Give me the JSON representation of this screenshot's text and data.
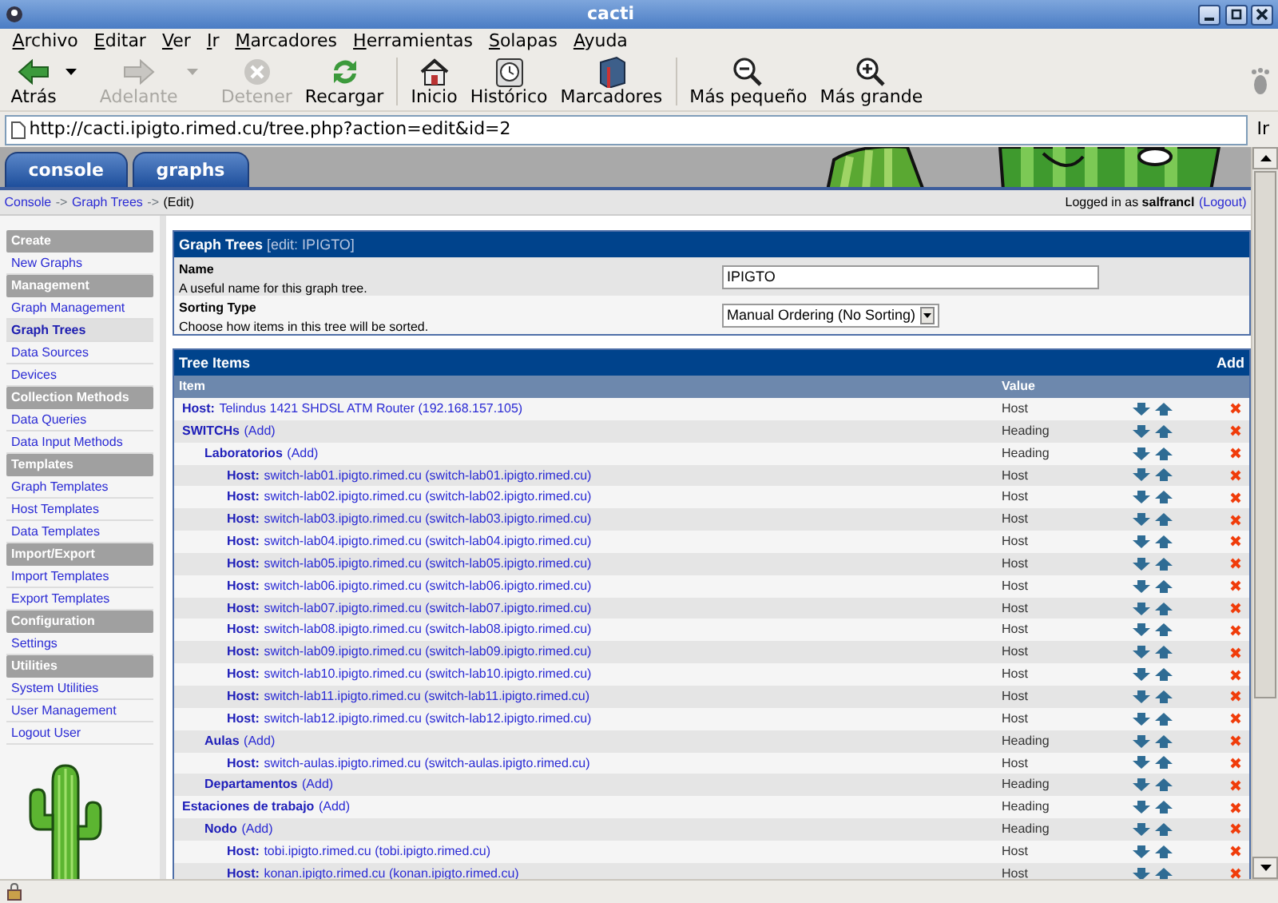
{
  "window": {
    "title": "cacti"
  },
  "menu": [
    "Archivo",
    "Editar",
    "Ver",
    "Ir",
    "Marcadores",
    "Herramientas",
    "Solapas",
    "Ayuda"
  ],
  "toolbar": [
    {
      "kind": "back",
      "label": "Atrás",
      "disabled": false,
      "dropdown": true
    },
    {
      "kind": "forward",
      "label": "Adelante",
      "disabled": true,
      "dropdown": true
    },
    {
      "kind": "stop",
      "label": "Detener",
      "disabled": true,
      "dropdown": false
    },
    {
      "kind": "reload",
      "label": "Recargar",
      "disabled": false,
      "dropdown": false
    },
    {
      "kind": "sep"
    },
    {
      "kind": "home",
      "label": "Inicio",
      "disabled": false,
      "dropdown": false
    },
    {
      "kind": "history",
      "label": "Histórico",
      "disabled": false,
      "dropdown": false
    },
    {
      "kind": "bookmarks",
      "label": "Marcadores",
      "disabled": false,
      "dropdown": false
    },
    {
      "kind": "sep"
    },
    {
      "kind": "zoomout",
      "label": "Más pequeño",
      "disabled": false,
      "dropdown": false
    },
    {
      "kind": "zoomin",
      "label": "Más grande",
      "disabled": false,
      "dropdown": false
    }
  ],
  "address": {
    "url": "http://cacti.ipigto.rimed.cu/tree.php?action=edit&id=2",
    "go": "Ir"
  },
  "tabs": [
    "console",
    "graphs"
  ],
  "breadcrumb": [
    {
      "kind": "link",
      "text": "Console"
    },
    {
      "kind": "sep",
      "text": "->"
    },
    {
      "kind": "link",
      "text": "Graph Trees"
    },
    {
      "kind": "sep",
      "text": "->"
    },
    {
      "kind": "text",
      "text": "(Edit)"
    }
  ],
  "login": {
    "text": "Logged in as **salfrancl**",
    "link": "(Logout)"
  },
  "sidebar": [
    {
      "title": "Create",
      "items": [
        {
          "label": "New Graphs",
          "selected": false
        }
      ]
    },
    {
      "title": "Management",
      "items": [
        {
          "label": "Graph Management",
          "selected": false
        },
        {
          "label": "Graph Trees",
          "selected": true
        },
        {
          "label": "Data Sources",
          "selected": false
        },
        {
          "label": "Devices",
          "selected": false
        }
      ]
    },
    {
      "title": "Collection Methods",
      "items": [
        {
          "label": "Data Queries",
          "selected": false
        },
        {
          "label": "Data Input Methods",
          "selected": false
        }
      ]
    },
    {
      "title": "Templates",
      "items": [
        {
          "label": "Graph Templates",
          "selected": false
        },
        {
          "label": "Host Templates",
          "selected": false
        },
        {
          "label": "Data Templates",
          "selected": false
        }
      ]
    },
    {
      "title": "Import/Export",
      "items": [
        {
          "label": "Import Templates",
          "selected": false
        },
        {
          "label": "Export Templates",
          "selected": false
        }
      ]
    },
    {
      "title": "Configuration",
      "items": [
        {
          "label": "Settings",
          "selected": false
        }
      ]
    },
    {
      "title": "Utilities",
      "items": [
        {
          "label": "System Utilities",
          "selected": false
        },
        {
          "label": "User Management",
          "selected": false
        },
        {
          "label": "Logout User",
          "selected": false
        }
      ]
    }
  ],
  "form": {
    "title": "Graph Trees",
    "subtitle": "[edit: IPIGTO]",
    "fields": [
      {
        "kind": "text",
        "label": "Name",
        "description": "A useful name for this graph tree.",
        "value": "IPIGTO"
      },
      {
        "kind": "select",
        "label": "Sorting Type",
        "description": "Choose how items in this tree will be sorted.",
        "value": "Manual Ordering (No Sorting)"
      }
    ]
  },
  "tree": {
    "title": "Tree Items",
    "add": "Add",
    "columns": [
      "Item",
      "Value"
    ],
    "items": [
      {
        "kind": "host",
        "label": "Host:",
        "text": "Telindus 1421 SHDSL ATM Router (192.168.157.105)",
        "value": "Host"
      },
      {
        "kind": "heading",
        "text": "SWITCHs",
        "add": "(Add)",
        "value": "Heading",
        "children": [
          {
            "kind": "heading",
            "text": "Laboratorios",
            "add": "(Add)",
            "value": "Heading",
            "children": [
              {
                "kind": "host",
                "label": "Host:",
                "text": "switch-lab01.ipigto.rimed.cu (switch-lab01.ipigto.rimed.cu)",
                "value": "Host"
              },
              {
                "kind": "host",
                "label": "Host:",
                "text": "switch-lab02.ipigto.rimed.cu (switch-lab02.ipigto.rimed.cu)",
                "value": "Host"
              },
              {
                "kind": "host",
                "label": "Host:",
                "text": "switch-lab03.ipigto.rimed.cu (switch-lab03.ipigto.rimed.cu)",
                "value": "Host"
              },
              {
                "kind": "host",
                "label": "Host:",
                "text": "switch-lab04.ipigto.rimed.cu (switch-lab04.ipigto.rimed.cu)",
                "value": "Host"
              },
              {
                "kind": "host",
                "label": "Host:",
                "text": "switch-lab05.ipigto.rimed.cu (switch-lab05.ipigto.rimed.cu)",
                "value": "Host"
              },
              {
                "kind": "host",
                "label": "Host:",
                "text": "switch-lab06.ipigto.rimed.cu (switch-lab06.ipigto.rimed.cu)",
                "value": "Host"
              },
              {
                "kind": "host",
                "label": "Host:",
                "text": "switch-lab07.ipigto.rimed.cu (switch-lab07.ipigto.rimed.cu)",
                "value": "Host"
              },
              {
                "kind": "host",
                "label": "Host:",
                "text": "switch-lab08.ipigto.rimed.cu (switch-lab08.ipigto.rimed.cu)",
                "value": "Host"
              },
              {
                "kind": "host",
                "label": "Host:",
                "text": "switch-lab09.ipigto.rimed.cu (switch-lab09.ipigto.rimed.cu)",
                "value": "Host"
              },
              {
                "kind": "host",
                "label": "Host:",
                "text": "switch-lab10.ipigto.rimed.cu (switch-lab10.ipigto.rimed.cu)",
                "value": "Host"
              },
              {
                "kind": "host",
                "label": "Host:",
                "text": "switch-lab11.ipigto.rimed.cu (switch-lab11.ipigto.rimed.cu)",
                "value": "Host"
              },
              {
                "kind": "host",
                "label": "Host:",
                "text": "switch-lab12.ipigto.rimed.cu (switch-lab12.ipigto.rimed.cu)",
                "value": "Host"
              }
            ]
          },
          {
            "kind": "heading",
            "text": "Aulas",
            "add": "(Add)",
            "value": "Heading",
            "children": [
              {
                "kind": "host",
                "label": "Host:",
                "text": "switch-aulas.ipigto.rimed.cu (switch-aulas.ipigto.rimed.cu)",
                "value": "Host"
              }
            ]
          },
          {
            "kind": "heading",
            "text": "Departamentos",
            "add": "(Add)",
            "value": "Heading"
          }
        ]
      },
      {
        "kind": "heading",
        "text": "Estaciones de trabajo",
        "add": "(Add)",
        "value": "Heading",
        "children": [
          {
            "kind": "heading",
            "text": "Nodo",
            "add": "(Add)",
            "value": "Heading",
            "children": [
              {
                "kind": "host",
                "label": "Host:",
                "text": "tobi.ipigto.rimed.cu (tobi.ipigto.rimed.cu)",
                "value": "Host"
              },
              {
                "kind": "host",
                "label": "Host:",
                "text": "konan.ipigto.rimed.cu (konan.ipigto.rimed.cu)",
                "value": "Host"
              }
            ]
          }
        ]
      }
    ]
  }
}
